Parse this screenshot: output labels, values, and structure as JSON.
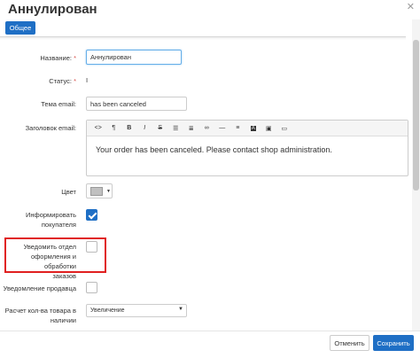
{
  "dialog": {
    "title": "Аннулирован",
    "close_icon": "✕"
  },
  "tabs": [
    {
      "label": "Общее"
    }
  ],
  "form": {
    "name": {
      "label": "Название:",
      "required_mark": "*",
      "value": "Аннулирован"
    },
    "status": {
      "label": "Статус:",
      "required_mark": "*",
      "value": "I"
    },
    "email_subject": {
      "label": "Тема email:",
      "value": "has been canceled"
    },
    "email_header": {
      "label": "Заголовок email:",
      "toolbar": [
        "code-icon",
        "paragraph-icon",
        "bold-icon",
        "italic-icon",
        "strikethrough-icon",
        "unordered-list-icon",
        "ordered-list-icon",
        "link-icon",
        "horizontal-rule-icon",
        "align-icon",
        "font-color-icon",
        "image-icon",
        "video-icon"
      ],
      "content": "Your order has been canceled. Please contact shop administration."
    },
    "color": {
      "label": "Цвет",
      "value_hex": "#c0c0c0"
    },
    "notify_customer": {
      "label_line1": "Информировать",
      "label_line2": "покупателя",
      "checked": true
    },
    "notify_dept": {
      "label_line1": "Уведомить отдел",
      "label_line2": "оформления и обработки",
      "label_line3": "заказов",
      "checked": false
    },
    "notify_vendor": {
      "label": "Уведомление продавца",
      "checked": false
    },
    "stock_calc": {
      "label_line1": "Расчет кол-ва товара в",
      "label_line2": "наличии",
      "selected": "Увеличение"
    }
  },
  "footer": {
    "cancel_label": "Отменить",
    "save_label": "Сохранить"
  },
  "colors": {
    "primary": "#1f6fc5",
    "highlight": "#e02020"
  }
}
